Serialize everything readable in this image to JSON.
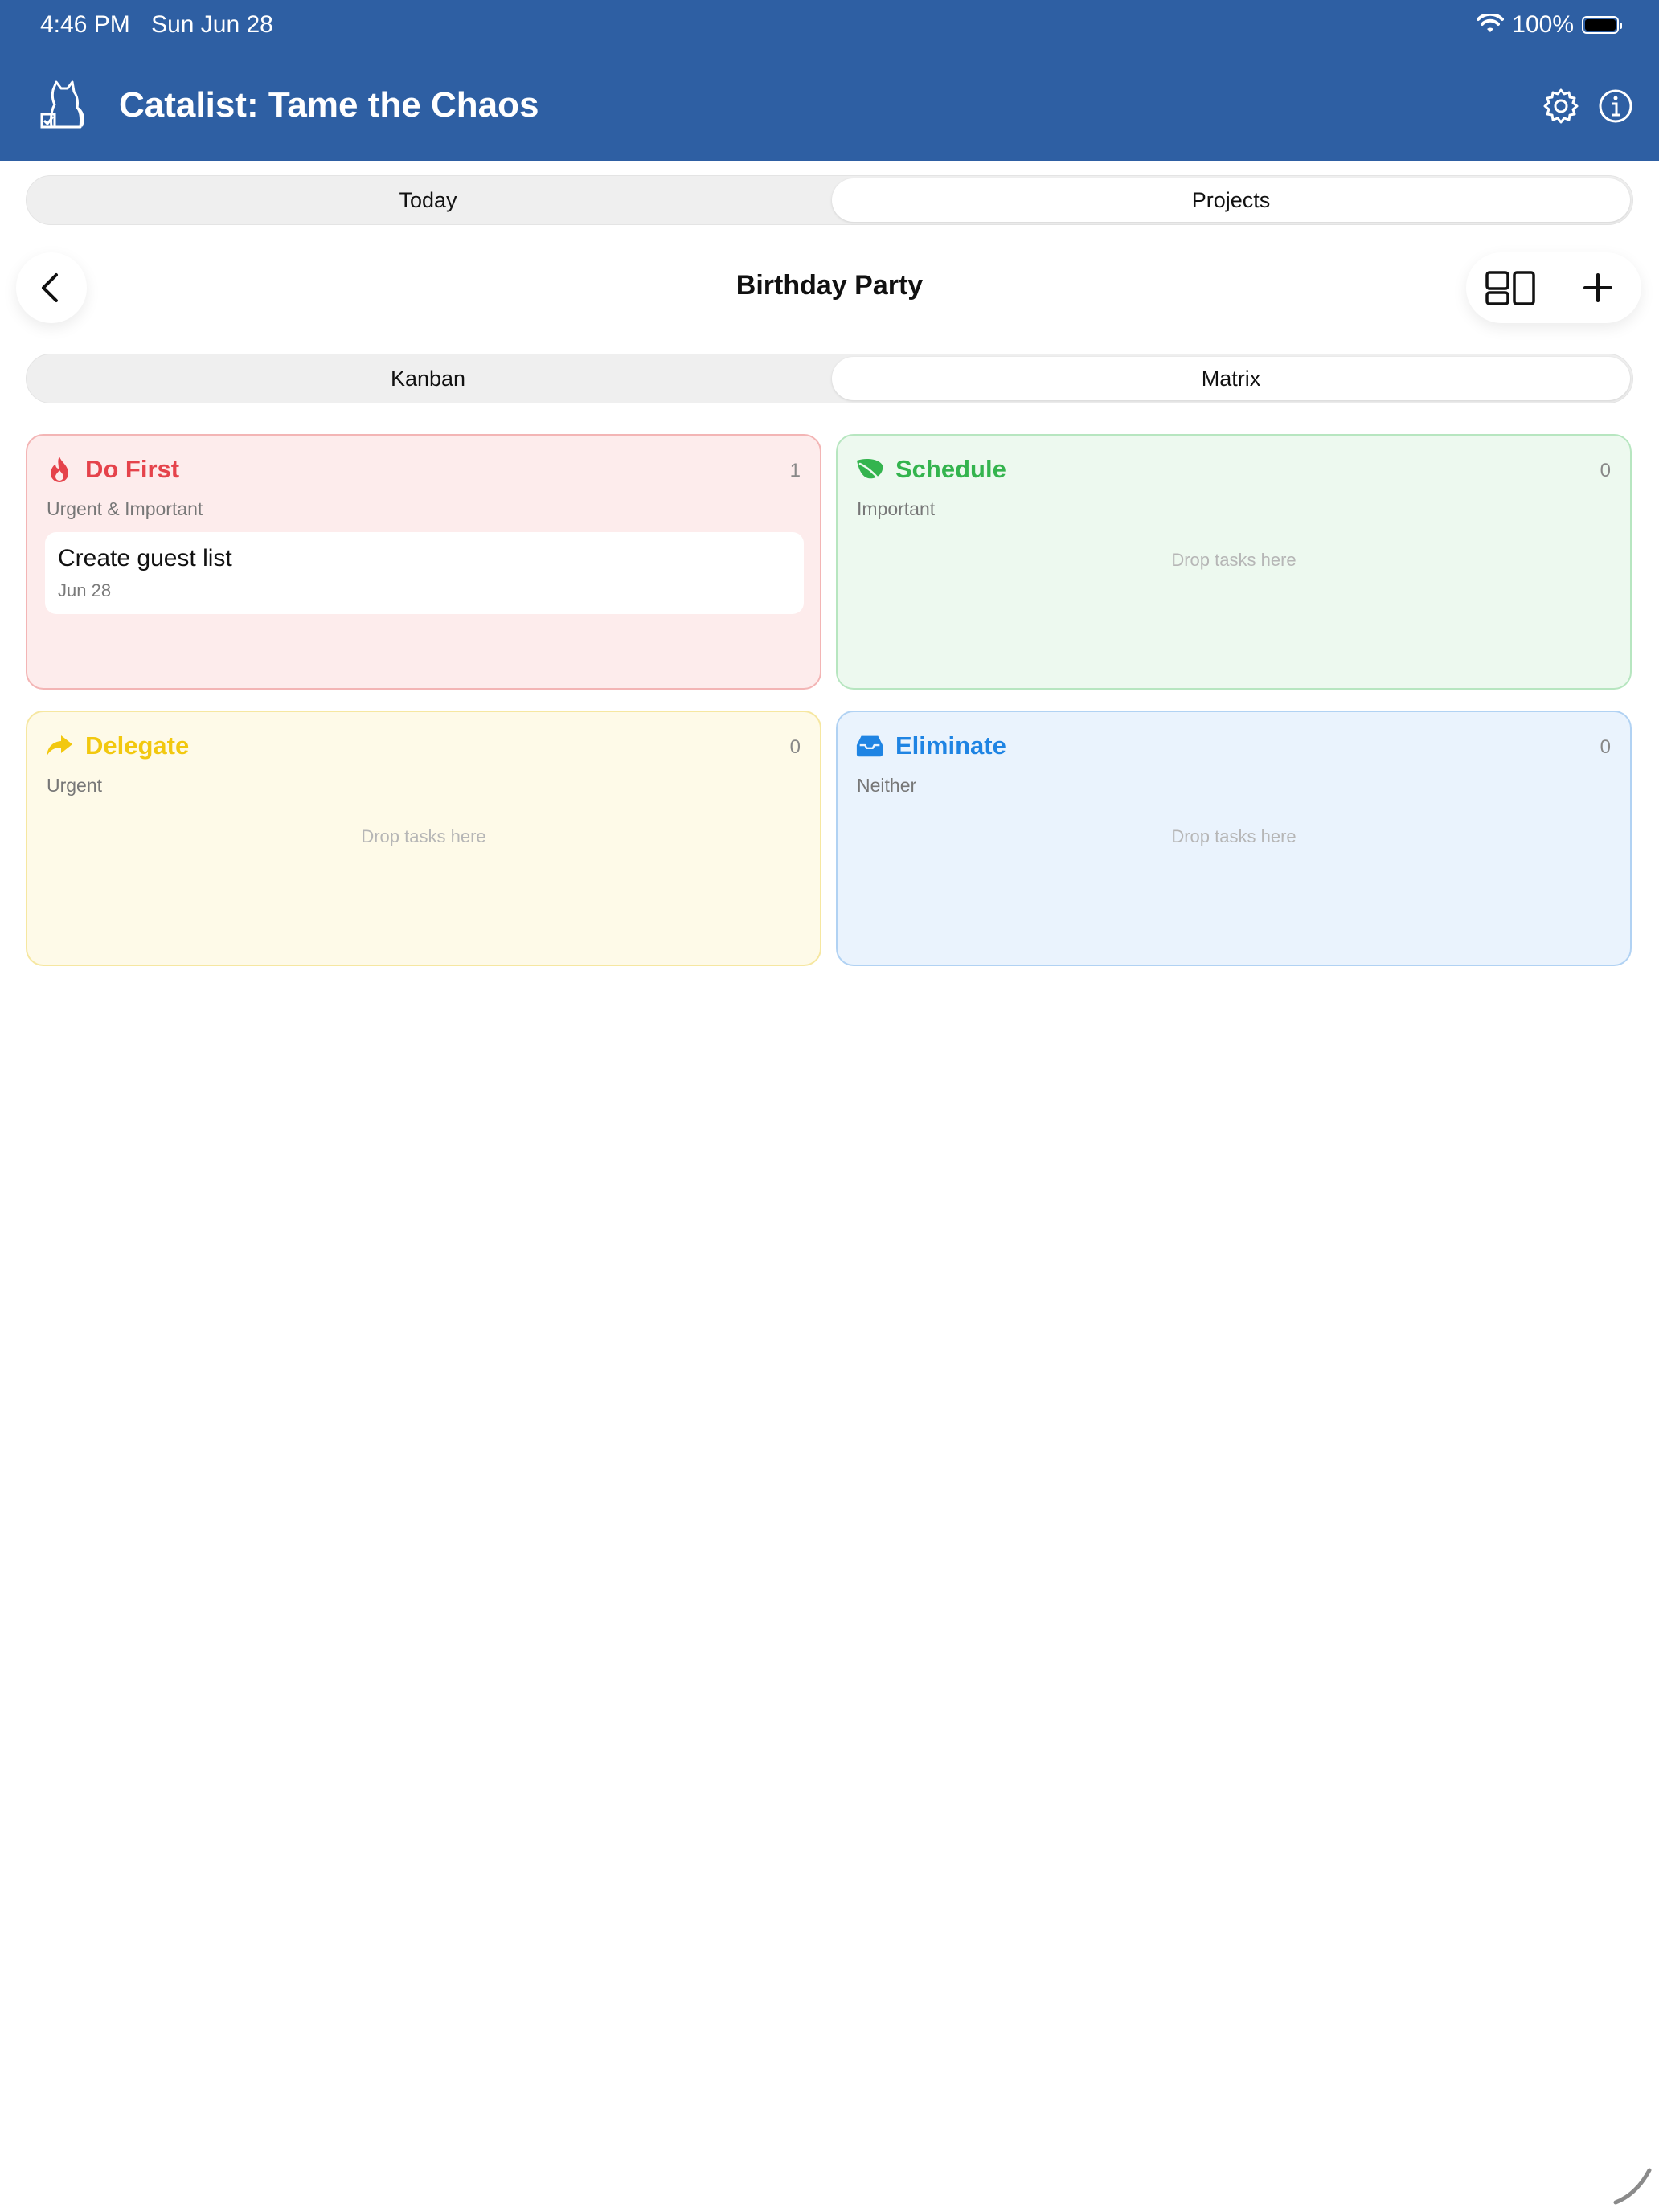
{
  "status_bar": {
    "time": "4:46 PM",
    "date": "Sun Jun 28",
    "battery": "100%"
  },
  "header": {
    "title": "Catalist: Tame the Chaos"
  },
  "main_tabs": [
    {
      "label": "Today",
      "active": false
    },
    {
      "label": "Projects",
      "active": true
    }
  ],
  "project": {
    "title": "Birthday Party"
  },
  "view_tabs": [
    {
      "label": "Kanban",
      "active": false
    },
    {
      "label": "Matrix",
      "active": true
    }
  ],
  "quadrants": {
    "do_first": {
      "title": "Do First",
      "subtitle": "Urgent & Important",
      "count": "1",
      "color": "#e5434b",
      "tasks": [
        {
          "title": "Create guest list",
          "date": "Jun 28"
        }
      ]
    },
    "schedule": {
      "title": "Schedule",
      "subtitle": "Important",
      "count": "0",
      "color": "#34b44e",
      "empty_text": "Drop tasks here"
    },
    "delegate": {
      "title": "Delegate",
      "subtitle": "Urgent",
      "count": "0",
      "color": "#f2c80f",
      "empty_text": "Drop tasks here"
    },
    "eliminate": {
      "title": "Eliminate",
      "subtitle": "Neither",
      "count": "0",
      "color": "#1f84e3",
      "empty_text": "Drop tasks here"
    }
  },
  "colors": {
    "header_bg": "#2e5fa3"
  }
}
